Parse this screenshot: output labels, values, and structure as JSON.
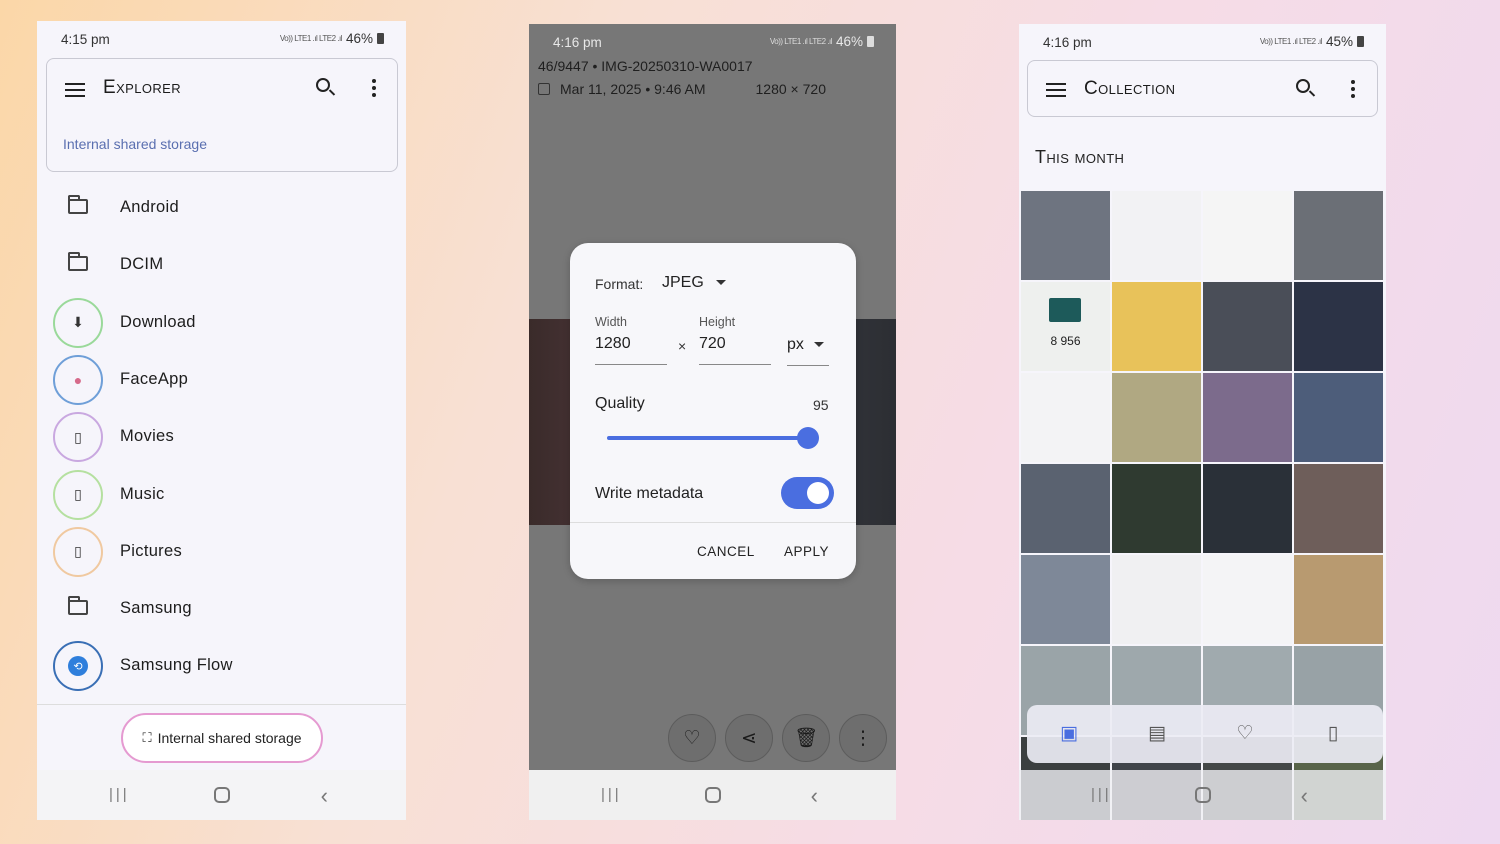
{
  "explorer": {
    "status": {
      "time": "4:15 pm",
      "signal": "Vo)) LTE1 .ıl LTE2 .ıl",
      "battery": "46%"
    },
    "title": "Explorer",
    "breadcrumb": "Internal shared storage",
    "items": [
      {
        "label": "Android",
        "icon": "folder-icon",
        "ring": ""
      },
      {
        "label": "DCIM",
        "icon": "folder-icon",
        "ring": ""
      },
      {
        "label": "Download",
        "icon": "download-icon",
        "ring": "#9ad99a"
      },
      {
        "label": "FaceApp",
        "icon": "faceapp-icon",
        "ring": "#6f9fd8"
      },
      {
        "label": "Movies",
        "icon": "bookmark-icon",
        "ring": "#c9a8e0"
      },
      {
        "label": "Music",
        "icon": "bookmark-icon",
        "ring": "#b5e0a0"
      },
      {
        "label": "Pictures",
        "icon": "bookmark-icon",
        "ring": "#f0c9a0"
      },
      {
        "label": "Samsung",
        "icon": "folder-icon",
        "ring": ""
      },
      {
        "label": "Samsung Flow",
        "icon": "samsung-flow-icon",
        "ring": "#3a6fb5"
      }
    ],
    "storage_button": "Internal shared storage"
  },
  "viewer": {
    "status": {
      "time": "4:16 pm",
      "signal": "Vo)) LTE1 .ıl LTE2 .ıl",
      "battery": "46%"
    },
    "file_info": "46/9447 • IMG-20250310-WA0017",
    "date": "Mar 11, 2025 • 9:46 AM",
    "dimensions": "1280 × 720",
    "dialog": {
      "format_label": "Format:",
      "format_value": "JPEG",
      "width_label": "Width",
      "width_value": "1280",
      "times": "×",
      "height_label": "Height",
      "height_value": "720",
      "unit": "px",
      "quality_label": "Quality",
      "quality_value": "95",
      "write_metadata_label": "Write metadata",
      "write_metadata": true,
      "cancel": "CANCEL",
      "apply": "APPLY"
    },
    "actions": [
      "heart-icon",
      "share-icon",
      "delete-icon",
      "more-icon"
    ]
  },
  "collection": {
    "status": {
      "time": "4:16 pm",
      "signal": "Vo)) LTE1 .ıl LTE2 .ıl",
      "battery": "45%"
    },
    "title": "Collection",
    "section": "This month",
    "highlight_count": "8 956",
    "tabs": [
      "photos-icon",
      "movies-icon",
      "favorites-icon",
      "bookmark-icon"
    ],
    "tile_colors": [
      "#6e7480",
      "#f2f2f4",
      "#f5f5f5",
      "#6b6f76",
      "#eef0ee",
      "#e8c25a",
      "#4a4e58",
      "#2c3346",
      "#f3f3f5",
      "#b0a882",
      "#7c6b8c",
      "#4d5d7a",
      "#5a6270",
      "#2f3a30",
      "#2a3038",
      "#6e5e5a",
      "#7e8898",
      "#f0f0f2",
      "#f4f4f6",
      "#b89a70",
      "#9aa4a8",
      "#9ea8ac",
      "#a0aaae",
      "#98a2a6",
      "#3b3f40",
      "#40444a",
      "#444848",
      "#58644a"
    ]
  }
}
